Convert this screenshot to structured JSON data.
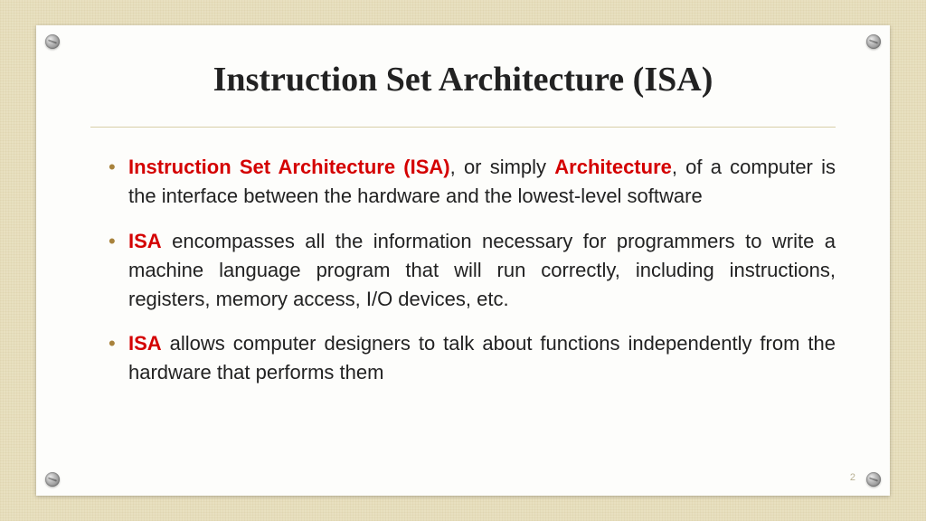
{
  "title": "Instruction Set Architecture (ISA)",
  "bullets": [
    {
      "parts": [
        {
          "text": "Instruction Set Architecture (ISA)",
          "em": true
        },
        {
          "text": ", or simply ",
          "em": false
        },
        {
          "text": "Architecture",
          "em": true
        },
        {
          "text": ", of a computer is the interface between the hardware and the lowest-level software",
          "em": false
        }
      ]
    },
    {
      "parts": [
        {
          "text": "ISA",
          "em": true
        },
        {
          "text": " encompasses all the information necessary for programmers to write a machine language program that will run correctly, including instructions, registers, memory access, I/O devices, etc.",
          "em": false
        }
      ]
    },
    {
      "parts": [
        {
          "text": "ISA",
          "em": true
        },
        {
          "text": " allows computer designers to talk about functions independently from the hardware that performs them",
          "em": false
        }
      ]
    }
  ],
  "pageNumber": "2"
}
